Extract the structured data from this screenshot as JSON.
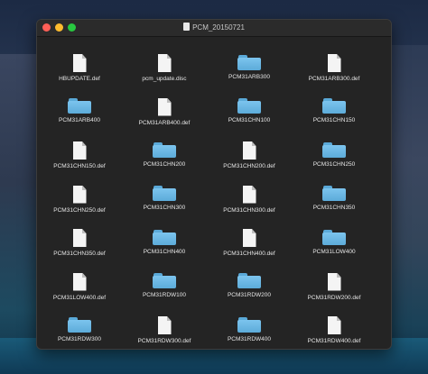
{
  "window": {
    "title": "PCM_20150721"
  },
  "items": [
    {
      "name": "HBUPDATE.def",
      "kind": "file"
    },
    {
      "name": "pcm_update.disc",
      "kind": "file"
    },
    {
      "name": "PCM31ARB300",
      "kind": "folder"
    },
    {
      "name": "PCM31ARB300.def",
      "kind": "file"
    },
    {
      "name": "PCM31ARB400",
      "kind": "folder"
    },
    {
      "name": "PCM31ARB400.def",
      "kind": "file"
    },
    {
      "name": "PCM31CHN100",
      "kind": "folder"
    },
    {
      "name": "PCM31CHN150",
      "kind": "folder"
    },
    {
      "name": "PCM31CHN150.def",
      "kind": "file"
    },
    {
      "name": "PCM31CHN200",
      "kind": "folder"
    },
    {
      "name": "PCM31CHN200.def",
      "kind": "file"
    },
    {
      "name": "PCM31CHN250",
      "kind": "folder"
    },
    {
      "name": "PCM31CHN250.def",
      "kind": "file"
    },
    {
      "name": "PCM31CHN300",
      "kind": "folder"
    },
    {
      "name": "PCM31CHN300.def",
      "kind": "file"
    },
    {
      "name": "PCM31CHN350",
      "kind": "folder"
    },
    {
      "name": "PCM31CHN350.def",
      "kind": "file"
    },
    {
      "name": "PCM31CHN400",
      "kind": "folder"
    },
    {
      "name": "PCM31CHN400.def",
      "kind": "file"
    },
    {
      "name": "PCM31LOW400",
      "kind": "folder"
    },
    {
      "name": "PCM31LOW400.def",
      "kind": "file"
    },
    {
      "name": "PCM31RDW100",
      "kind": "folder"
    },
    {
      "name": "PCM31RDW200",
      "kind": "folder"
    },
    {
      "name": "PCM31RDW200.def",
      "kind": "file"
    },
    {
      "name": "PCM31RDW300",
      "kind": "folder"
    },
    {
      "name": "PCM31RDW300.def",
      "kind": "file"
    },
    {
      "name": "PCM31RDW400",
      "kind": "folder"
    },
    {
      "name": "PCM31RDW400.def",
      "kind": "file"
    }
  ],
  "colors": {
    "window_bg": "#242424",
    "folder": "#6bb8e6",
    "close": "#ff5f57",
    "minimize": "#febc2e",
    "maximize": "#28c840"
  }
}
